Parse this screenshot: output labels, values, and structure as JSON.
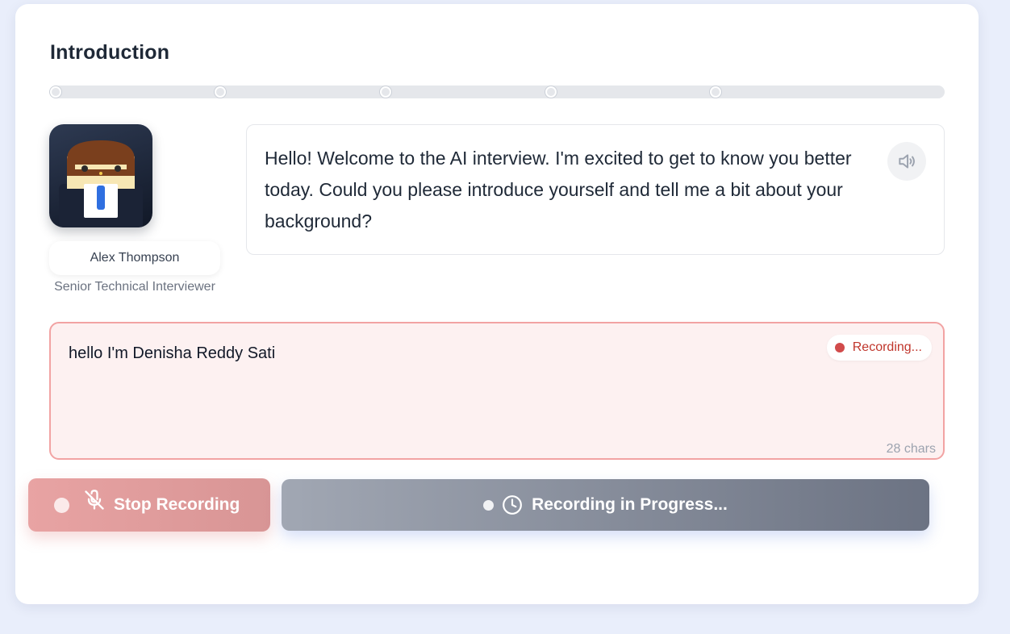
{
  "header": {
    "title": "Introduction"
  },
  "progress": {
    "steps": 5,
    "current_step": 1
  },
  "interviewer": {
    "name": "Alex Thompson",
    "role": "Senior Technical Interviewer",
    "avatar_icon": "interviewer-avatar-icon"
  },
  "question": {
    "text": "Hello! Welcome to the AI interview. I'm excited to get to know you better today. Could you please introduce yourself and tell me a bit about your background?",
    "speaker_icon": "speaker-icon"
  },
  "answer": {
    "transcript": "hello I'm Denisha Reddy Sati",
    "status_label": "Recording...",
    "char_count": "28 chars"
  },
  "actions": {
    "stop_label": "Stop Recording",
    "stop_icon": "mic-off-icon",
    "progress_label": "Recording in Progress...",
    "progress_icon": "clock-icon"
  },
  "colors": {
    "background": "#e9eefb",
    "recording_red": "#d14b4b",
    "recording_border": "#f2a3a3",
    "stop_button": "#e8a3a3",
    "progress_button_start": "#a1a7b3",
    "progress_button_end": "#6c7383"
  }
}
